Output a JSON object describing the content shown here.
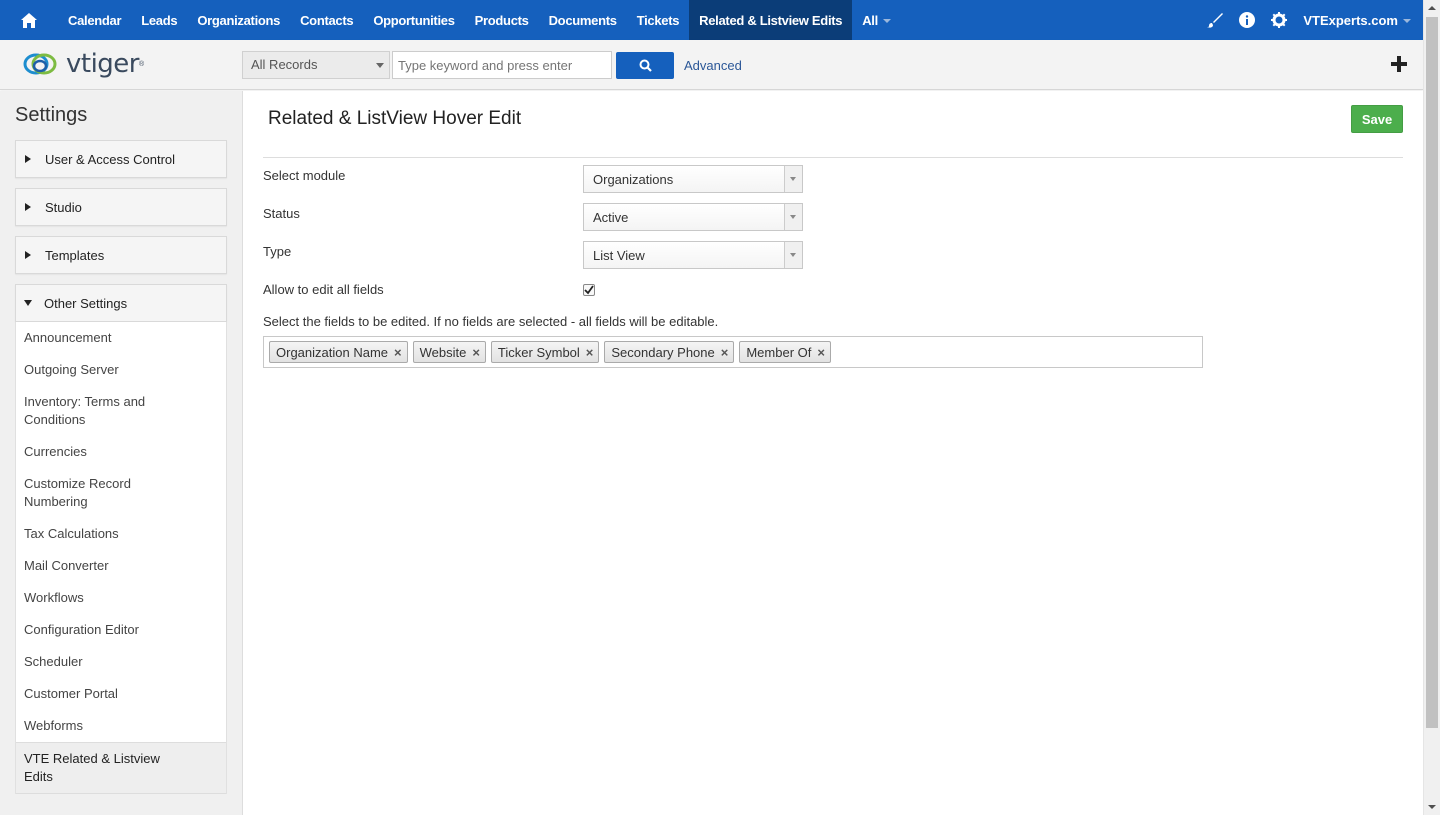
{
  "topnav": {
    "items": [
      {
        "label": "Calendar"
      },
      {
        "label": "Leads"
      },
      {
        "label": "Organizations"
      },
      {
        "label": "Contacts"
      },
      {
        "label": "Opportunities"
      },
      {
        "label": "Products"
      },
      {
        "label": "Documents"
      },
      {
        "label": "Tickets"
      },
      {
        "label": "Related & Listview Edits"
      },
      {
        "label": "All"
      }
    ],
    "user": "VTExperts.com",
    "bg_color": "#1560bd",
    "active_color": "#0b3d78"
  },
  "header": {
    "logo_text": "vtiger",
    "records_select": "All Records",
    "search_placeholder": "Type keyword and press enter",
    "advanced_label": "Advanced"
  },
  "sidebar": {
    "title": "Settings",
    "sections": [
      {
        "label": "User & Access Control",
        "expanded": false
      },
      {
        "label": "Studio",
        "expanded": false
      },
      {
        "label": "Templates",
        "expanded": false
      },
      {
        "label": "Other Settings",
        "expanded": true
      }
    ],
    "other_settings_items": [
      {
        "label": "Announcement"
      },
      {
        "label": "Outgoing Server"
      },
      {
        "label": "Inventory: Terms and",
        "label2": "Conditions"
      },
      {
        "label": "Currencies"
      },
      {
        "label": "Customize Record",
        "label2": "Numbering"
      },
      {
        "label": "Tax Calculations"
      },
      {
        "label": "Mail Converter"
      },
      {
        "label": "Workflows"
      },
      {
        "label": "Configuration Editor"
      },
      {
        "label": "Scheduler"
      },
      {
        "label": "Customer Portal"
      },
      {
        "label": "Webforms"
      },
      {
        "label": "VTE Related & Listview",
        "label2": "Edits",
        "selected": true
      }
    ]
  },
  "main": {
    "title": "Related & ListView Hover Edit",
    "save_label": "Save",
    "save_color": "#4cae4c",
    "fields": {
      "module_label": "Select module",
      "module_value": "Organizations",
      "status_label": "Status",
      "status_value": "Active",
      "type_label": "Type",
      "type_value": "List View",
      "allow_label": "Allow to edit all fields",
      "allow_checked": true
    },
    "help_text": "Select the fields to be edited. If no fields are selected - all fields will be editable.",
    "selected_fields": [
      "Organization Name",
      "Website",
      "Ticker Symbol",
      "Secondary Phone",
      "Member Of"
    ]
  }
}
